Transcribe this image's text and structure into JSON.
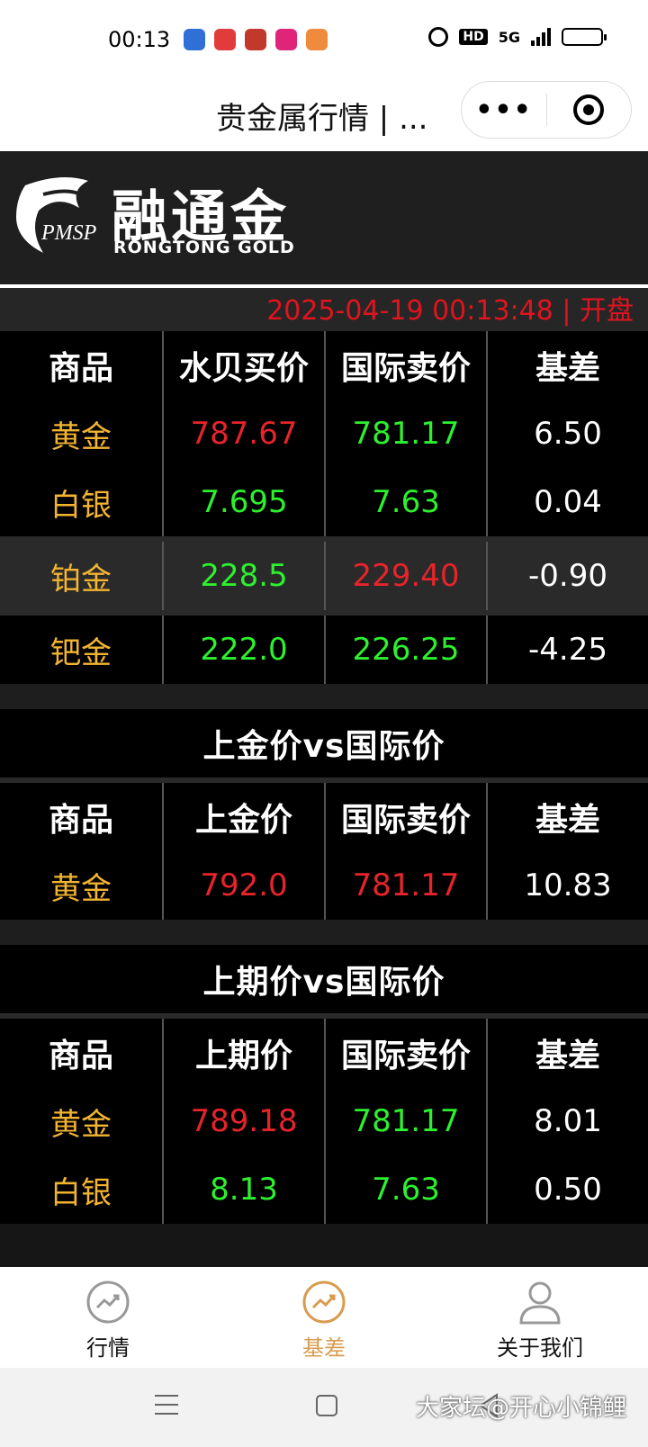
{
  "status_bar": {
    "time": "00:13",
    "hd": "HD",
    "network": "5G",
    "app_colors": [
      "#2f6fd6",
      "#e23b3b",
      "#c0392b",
      "#e0247a",
      "#f08a3c"
    ]
  },
  "title_bar": {
    "title": "贵金属行情 | ...",
    "more_label": "•••"
  },
  "brand": {
    "name": "融通金",
    "subtitle": "RONGTONG  GOLD",
    "pmsp": "PMSP"
  },
  "timestamp": "2025-04-19 00:13:48 | 开盘",
  "table1": {
    "headers": [
      "商品",
      "水贝买价",
      "国际卖价",
      "基差"
    ],
    "rows": [
      {
        "name": "黄金",
        "buy": "787.67",
        "sell": "781.17",
        "diff": "6.50"
      },
      {
        "name": "白银",
        "buy": "7.695",
        "sell": "7.63",
        "diff": "0.04"
      },
      {
        "name": "铂金",
        "buy": "228.5",
        "sell": "229.40",
        "diff": "-0.90"
      },
      {
        "name": "钯金",
        "buy": "222.0",
        "sell": "226.25",
        "diff": "-4.25"
      }
    ]
  },
  "section2": {
    "title": "上金价vs国际价",
    "headers": [
      "商品",
      "上金价",
      "国际卖价",
      "基差"
    ],
    "rows": [
      {
        "name": "黄金",
        "buy": "792.0",
        "sell": "781.17",
        "diff": "10.83"
      }
    ]
  },
  "section3": {
    "title": "上期价vs国际价",
    "headers": [
      "商品",
      "上期价",
      "国际卖价",
      "基差"
    ],
    "rows": [
      {
        "name": "黄金",
        "buy": "789.18",
        "sell": "781.17",
        "diff": "8.01"
      },
      {
        "name": "白银",
        "buy": "8.13",
        "sell": "7.63",
        "diff": "0.50"
      }
    ]
  },
  "tabbar": {
    "tabs": [
      {
        "label": "行情",
        "icon": "chart-trend-icon"
      },
      {
        "label": "基差",
        "icon": "chart-trend-icon"
      },
      {
        "label": "关于我们",
        "icon": "user-icon"
      }
    ],
    "active_color": "#d79c50"
  },
  "watermark": "大家坛@开心小锦鲤"
}
